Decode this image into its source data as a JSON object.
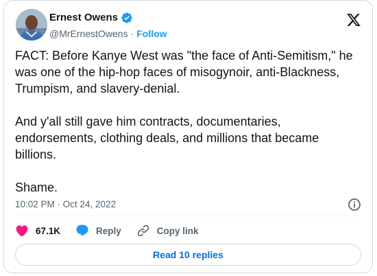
{
  "author": {
    "name": "Ernest Owens",
    "handle": "@MrErnestOwens",
    "separator": "·",
    "follow_label": "Follow",
    "verified_color": "#1d9bf0"
  },
  "tweet": {
    "paragraphs": [
      "FACT: Before Kanye West was \"the face of Anti-Semitism,\" he was one of the hip-hop faces of misogynoir, anti-Blackness, Trumpism, and slavery-denial.",
      "And y'all still gave him contracts, documentaries, endorsements, clothing deals, and millions that became billions.",
      "Shame."
    ],
    "timestamp": "10:02 PM · Oct 24, 2022"
  },
  "actions": {
    "like_count": "67.1K",
    "reply_label": "Reply",
    "copy_link_label": "Copy link"
  },
  "read_replies_label": "Read 10 replies",
  "icons": {
    "logo": "x-logo-icon",
    "verified": "verified-badge-icon",
    "info": "info-icon",
    "like": "heart-icon",
    "reply": "speech-bubble-icon",
    "copy": "link-icon"
  },
  "colors": {
    "accent": "#1d9bf0",
    "like": "#f91880",
    "secondary_text": "#536471",
    "border": "#cfd9de"
  }
}
